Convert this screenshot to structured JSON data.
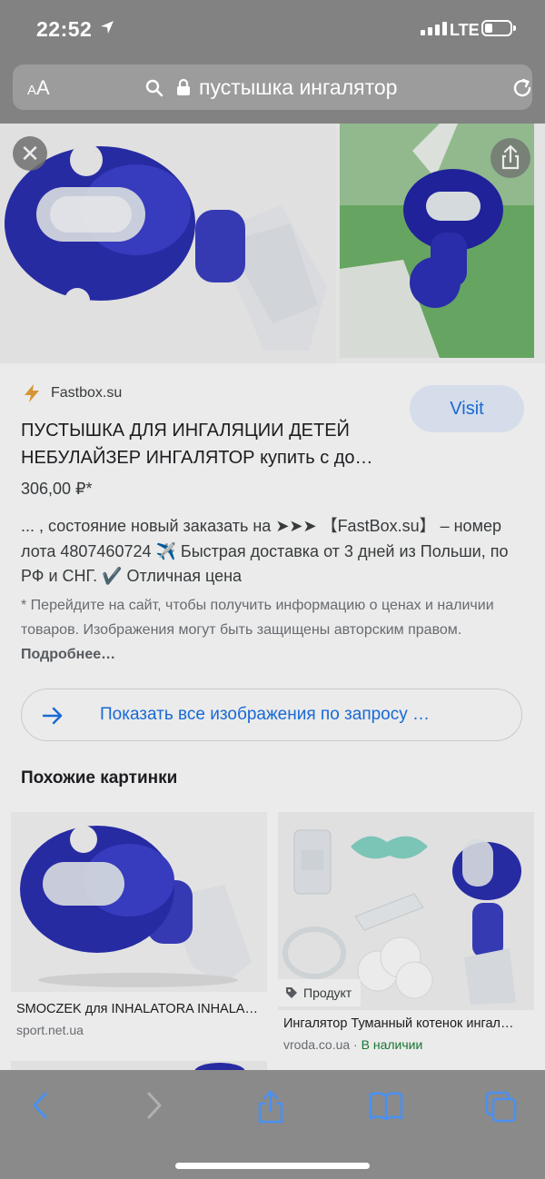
{
  "status_bar": {
    "time": "22:52",
    "network": "LTE"
  },
  "browser": {
    "text_size_label": "AA",
    "query": "пустышка ингалятор"
  },
  "result": {
    "source_name": "Fastbox.su",
    "visit_label": "Visit",
    "title": "ПУСТЫШКА ДЛЯ ИНГАЛЯЦИИ ДЕТЕЙ НЕБУЛАЙЗЕР ИНГАЛЯТОР купить с до…",
    "price": "306,00 ₽*",
    "description": "... , состояние новый заказать на ➤➤➤ 【FastBox.su】 – номер лота 4807460724 ✈️ Быстрая доставка от 3 дней из Польши, по РФ и СНГ. ✔️ Отличная цена",
    "note": "* Перейдите на сайт, чтобы получить информацию о ценах и наличии товаров. Изображения могут быть защищены авторским правом.",
    "note_more": "Подробнее…"
  },
  "show_all_label": "Показать все изображения по запросу …",
  "similar_heading": "Похожие картинки",
  "similar": [
    {
      "title": "SMOCZEK для INHALATORA INHALA…",
      "source": "sport.net.ua",
      "availability": ""
    },
    {
      "title": "Ингалятор Туманный котенок ингал…",
      "source": "vroda.co.ua",
      "availability": "В наличии",
      "tag": "Продукт"
    }
  ],
  "colors": {
    "accent": "#1a73e8",
    "visit_bg": "#e8f0fe",
    "chrome": "#828282",
    "pacifier": "#2b2fb0"
  }
}
